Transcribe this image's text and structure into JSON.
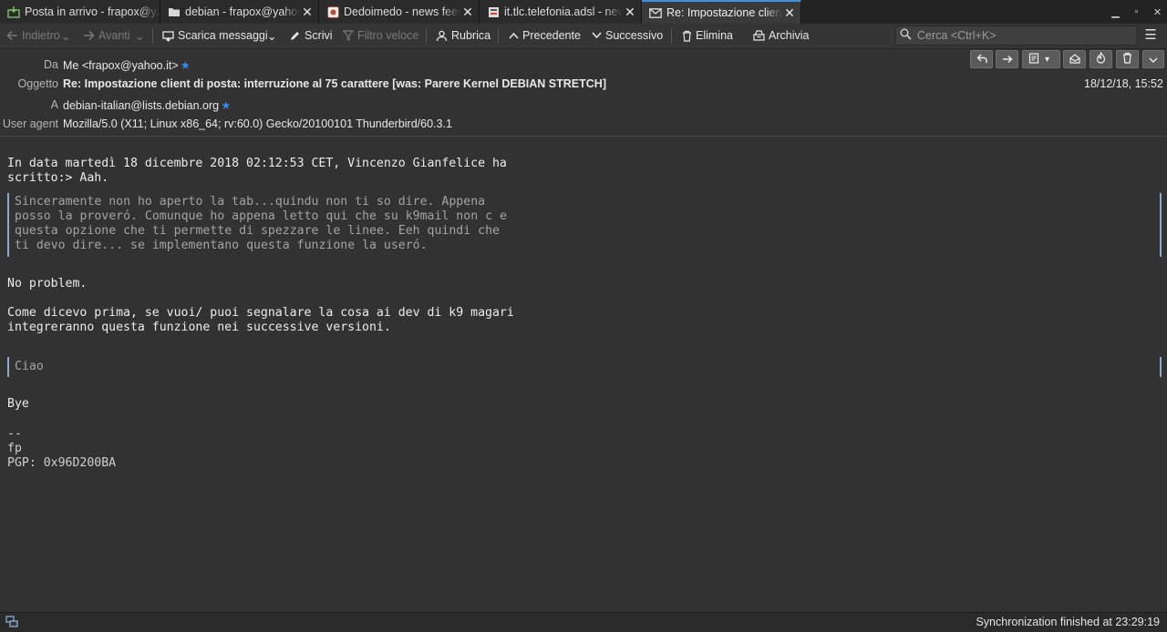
{
  "tabs": [
    {
      "label": "Posta in arrivo - frapox@yahoo.it",
      "icon": "inbox-icon"
    },
    {
      "label": "debian - frapox@yahoo.it",
      "icon": "folder-icon"
    },
    {
      "label": "Dedoimedo - news feed",
      "icon": "feed-icon"
    },
    {
      "label": "it.tlc.telefonia.adsl - news",
      "icon": "newsgroup-icon"
    },
    {
      "label": "Re: Impostazione client di posta",
      "icon": "mail-icon"
    }
  ],
  "toolbar": {
    "back": "Indietro",
    "forward": "Avanti",
    "get_messages": "Scarica messaggi",
    "write": "Scrivi",
    "quick_filter": "Filtro veloce",
    "address_book": "Rubrica",
    "previous": "Precedente",
    "next": "Successivo",
    "delete": "Elimina",
    "archive": "Archivia",
    "search_placeholder": "Cerca <Ctrl+K>"
  },
  "header": {
    "from_label": "Da",
    "from_value": "Me <frapox@yahoo.it>",
    "subject_label": "Oggetto",
    "subject_value": "Re: Impostazione client di posta: interruzione al 75 carattere [was: Parere Kernel DEBIAN STRETCH]",
    "to_label": "A",
    "to_value": "debian-italian@lists.debian.org",
    "ua_label": "User agent",
    "ua_value": "Mozilla/5.0 (X11; Linux x86_64; rv:60.0) Gecko/20100101 Thunderbird/60.3.1",
    "date": "18/12/18, 15:52"
  },
  "message": {
    "intro_line1": "In data martedì 18 dicembre 2018 02:12:53 CET, Vincenzo Gianfelice ha",
    "intro_line2": "scritto:> Aah.",
    "quote1": "Sinceramente non ho aperto la tab...quindu non ti so dire. Appena\nposso la proveró. Comunque ho appena letto qui che su k9mail non c e\nquesta opzione che ti permette di spezzare le linee. Eeh quindi che\nti devo dire... se implementano questa funzione la useró.",
    "reply1": "No problem.",
    "reply2_line1": "Come dicevo prima, se vuoi/ puoi segnalare la cosa ai dev di k9 magari",
    "reply2_line2": "integreranno questa funzione nei successive versioni.",
    "quote2": "Ciao",
    "closing": "Bye",
    "sig_sep": "--",
    "sig_name": "fp",
    "sig_pgp": "PGP: 0x96D200BA"
  },
  "status": {
    "text": "Synchronization finished at 23:29:19"
  },
  "colors": {
    "background": "#323232",
    "accent": "#3d8fe0",
    "star": "#2f8cf0"
  }
}
